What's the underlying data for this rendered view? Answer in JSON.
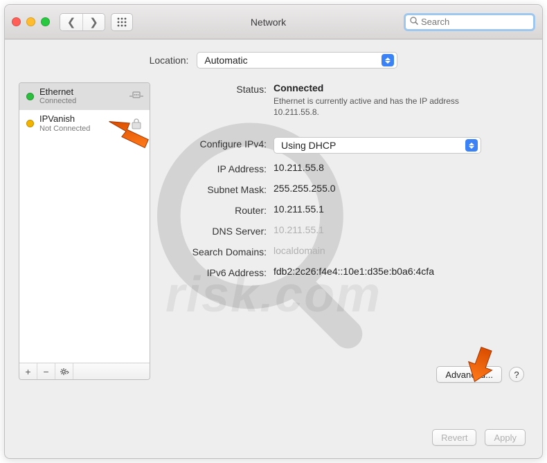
{
  "window": {
    "title": "Network"
  },
  "search": {
    "placeholder": "Search"
  },
  "location": {
    "label": "Location:",
    "value": "Automatic"
  },
  "sidebar": {
    "items": [
      {
        "name": "Ethernet",
        "status": "Connected",
        "dot": "green",
        "selected": true
      },
      {
        "name": "IPVanish",
        "status": "Not Connected",
        "dot": "amber",
        "selected": false
      }
    ]
  },
  "details": {
    "status_label": "Status:",
    "status_value": "Connected",
    "status_desc": "Ethernet is currently active and has the IP address 10.211.55.8.",
    "configure_label": "Configure IPv4:",
    "configure_value": "Using DHCP",
    "ip_label": "IP Address:",
    "ip_value": "10.211.55.8",
    "subnet_label": "Subnet Mask:",
    "subnet_value": "255.255.255.0",
    "router_label": "Router:",
    "router_value": "10.211.55.1",
    "dns_label": "DNS Server:",
    "dns_value": "10.211.55.1",
    "search_domains_label": "Search Domains:",
    "search_domains_value": "localdomain",
    "ipv6_label": "IPv6 Address:",
    "ipv6_value": "fdb2:2c26:f4e4::10e1:d35e:b0a6:4cfa",
    "advanced_label": "Advanced...",
    "help_label": "?"
  },
  "footer": {
    "revert": "Revert",
    "apply": "Apply"
  },
  "watermark": {
    "text": "risk.com"
  }
}
